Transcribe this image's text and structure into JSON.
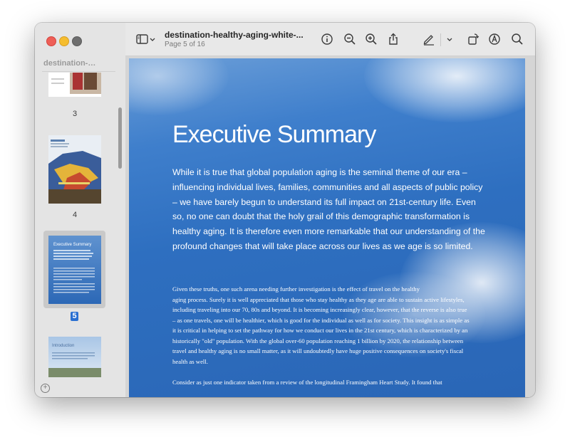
{
  "window": {
    "sidebar_title": "destination-…",
    "doc_title": "destination-healthy-aging-white-...",
    "page_indicator": "Page 5 of 16"
  },
  "thumbnails": [
    {
      "label": "3"
    },
    {
      "label": "4"
    },
    {
      "label": "5",
      "selected": true,
      "caption": "Executive Summary"
    },
    {
      "caption": "Introduction"
    }
  ],
  "toolbar": {
    "icons": [
      "sidebar-toggle-icon",
      "chevron-down-icon",
      "info-icon",
      "zoom-out-icon",
      "zoom-in-icon",
      "share-icon",
      "markup-pen-icon",
      "chevron-down-icon",
      "rotate-icon",
      "annotate-icon",
      "search-icon"
    ]
  },
  "page": {
    "title": "Executive Summary",
    "intro_lines": [
      "While it is true that global population aging is the seminal theme of our era –",
      "influencing individual lives, families, communities and all aspects of public policy",
      "– we have barely begun to understand its full impact on 21st-century life.  Even",
      "so, no one can doubt that the holy grail of this demographic transformation is",
      "healthy aging.  It is therefore even more remarkable that our understanding of the",
      "profound changes that will take place across our lives as we age is so limited."
    ],
    "body_lines": [
      "Given these truths, one such arena needing further investigation is the effect of travel on the healthy",
      "aging process. Surely it is well appreciated that those who stay healthy as they age are able to sustain active lifestyles,",
      "including traveling into our 70, 80s and beyond.  It is becoming increasingly clear, however, that the reverse is also true",
      "– as one travels, one will be healthier, which is good for the individual as well as for society.  This insight is as simple as",
      "it is critical in helping to set the pathway for how we conduct our lives in the 21st century, which is characterized by an",
      "historically \"old\" population. With the global over-60 population reaching 1 billion by 2020, the relationship between",
      "travel and healthy aging is no small matter, as it will undoubtedly have huge positive consequences on society's fiscal",
      "health as well."
    ],
    "body_last": "Consider as just one indicator taken from a review of the longitudinal Framingham Heart Study. It found that"
  }
}
